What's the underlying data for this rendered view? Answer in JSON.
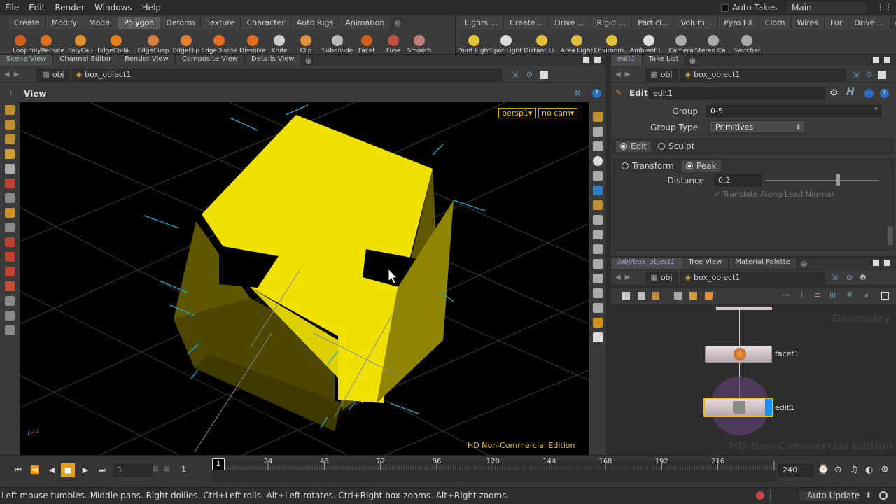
{
  "menubar": {
    "items": [
      "File",
      "Edit",
      "Render",
      "Windows",
      "Help"
    ],
    "auto_takes": "Auto Takes",
    "desktop": "Main"
  },
  "shelf_left": {
    "tabs": [
      "Create",
      "Modify",
      "Model",
      "Polygon",
      "Deform",
      "Texture",
      "Character",
      "Auto Rigs",
      "Animation"
    ],
    "active_tab": "Polygon",
    "tools": [
      {
        "label": "Loop",
        "icon": "loop-icon",
        "color": "#d06020"
      },
      {
        "label": "PolyReduce",
        "icon": "polyreduce-icon",
        "color": "#e07020"
      },
      {
        "label": "PolyCap",
        "icon": "polycap-icon",
        "color": "#e09030"
      },
      {
        "label": "EdgeColla...",
        "icon": "edgecollapse-icon",
        "color": "#e08020"
      },
      {
        "label": "EdgeCusp",
        "icon": "edgecusp-icon",
        "color": "#d08040"
      },
      {
        "label": "EdgeFlip",
        "icon": "edgeflip-icon",
        "color": "#e08030"
      },
      {
        "label": "EdgeDivide",
        "icon": "edgedivide-icon",
        "color": "#e07020"
      },
      {
        "label": "Dissolve",
        "icon": "dissolve-icon",
        "color": "#e07020"
      },
      {
        "label": "Knife",
        "icon": "knife-icon",
        "color": "#cccccc"
      },
      {
        "label": "Clip",
        "icon": "clip-icon",
        "color": "#e09040"
      },
      {
        "label": "Subdivide",
        "icon": "subdivide-icon",
        "color": "#bbbbbb"
      },
      {
        "label": "Facet",
        "icon": "facet-icon",
        "color": "#d06020"
      },
      {
        "label": "Fuse",
        "icon": "fuse-icon",
        "color": "#c05040"
      },
      {
        "label": "Smooth",
        "icon": "smooth-icon",
        "color": "#c08080"
      }
    ]
  },
  "shelf_right": {
    "tabs": [
      "Lights ...",
      "Create...",
      "Drive ...",
      "Rigid ...",
      "Particl...",
      "Volum...",
      "Pyro FX",
      "Cloth",
      "Wires",
      "Fur",
      "Drive ..."
    ],
    "tools": [
      {
        "label": "Point Light",
        "icon": "point-light-icon",
        "color": "#e0c040"
      },
      {
        "label": "Spot Light",
        "icon": "spot-light-icon",
        "color": "#dddddd"
      },
      {
        "label": "Distant Li...",
        "icon": "distant-light-icon",
        "color": "#e0c040"
      },
      {
        "label": "Area Light",
        "icon": "area-light-icon",
        "color": "#e0c040"
      },
      {
        "label": "Environm...",
        "icon": "environment-light-icon",
        "color": "#e0c040"
      },
      {
        "label": "Ambient L...",
        "icon": "ambient-light-icon",
        "color": "#dddddd"
      },
      {
        "label": "Camera",
        "icon": "camera-icon",
        "color": "#aaaaaa"
      },
      {
        "label": "Stereo Ca...",
        "icon": "stereo-camera-icon",
        "color": "#aaaaaa"
      },
      {
        "label": "Switcher",
        "icon": "switcher-icon",
        "color": "#aaaaaa"
      }
    ]
  },
  "left_pane": {
    "tabs": [
      "Scene View",
      "Channel Editor",
      "Render View",
      "Composite View",
      "Details View"
    ],
    "path_root": "obj",
    "path_node": "box_object1",
    "view_title": "View",
    "persp": "persp1",
    "cam": "no cam",
    "watermark": "HD Non-Commercial Edition"
  },
  "params": {
    "tabs": [
      "edit1",
      "Take List"
    ],
    "path_root": "obj",
    "path_node": "box_object1",
    "node_type": "Edit",
    "node_name": "edit1",
    "group_label": "Group",
    "group_value": "0-5",
    "group_type_label": "Group Type",
    "group_type_value": "Primitives",
    "mode_edit": "Edit",
    "mode_sculpt": "Sculpt",
    "xform_transform": "Transform",
    "xform_peak": "Peak",
    "distance_label": "Distance",
    "distance_value": "0.2",
    "distance_fraction": 0.65,
    "translate_label": "Translate Along Lead Normal"
  },
  "network": {
    "tabs": [
      "/obj/box_object1",
      "Tree View",
      "Material Palette"
    ],
    "path_root": "obj",
    "path_node": "box_object1",
    "context_label": "Geometry",
    "watermark": "HD Non-Commercial Edition",
    "nodes": [
      {
        "name": "facet1"
      },
      {
        "name": "edit1"
      }
    ]
  },
  "timeline": {
    "frame": "1",
    "start": "1",
    "end": "240",
    "current_marker": "1",
    "ticks": [
      "24",
      "48",
      "72",
      "96",
      "120",
      "144",
      "168",
      "192",
      "216"
    ]
  },
  "status": {
    "message": "Left mouse tumbles. Middle pans. Right dollies. Ctrl+Left rolls. Alt+Left rotates. Ctrl+Right box-zooms. Alt+Right zooms.",
    "auto_update": "Auto Update"
  },
  "colors": {
    "yellow": "#f0e000",
    "accent_blue": "#1e8cf0",
    "cyan_handles": "#2aa8c8"
  }
}
